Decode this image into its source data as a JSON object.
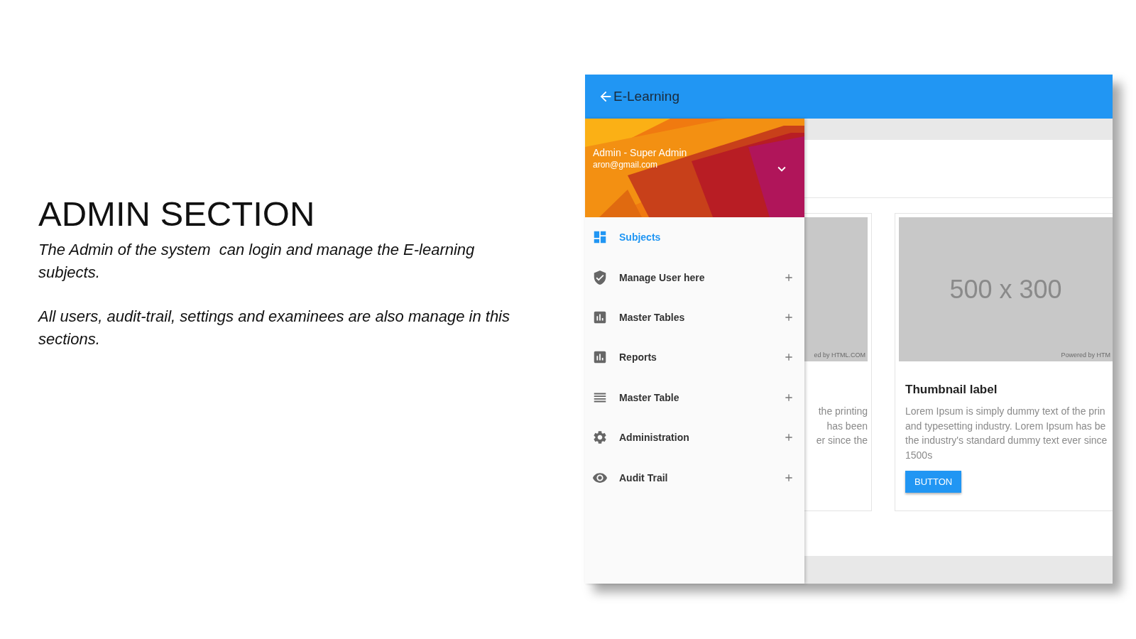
{
  "slide": {
    "title": "ADMIN SECTION",
    "paragraphs": [
      "The Admin of the system  can login and manage the E-learning subjects.",
      "All users, audit-trail, settings and examinees are also manage in this sections."
    ]
  },
  "app_bar": {
    "title": "E-Learning"
  },
  "profile": {
    "name": "Admin - Super Admin",
    "email": "aron@gmail.com"
  },
  "menu": [
    {
      "label": "Subjects",
      "kind": "dashboard",
      "selected": true,
      "expandable": false
    },
    {
      "label": "Manage User here",
      "kind": "shield",
      "selected": false,
      "expandable": true
    },
    {
      "label": "Master Tables",
      "kind": "chart",
      "selected": false,
      "expandable": true
    },
    {
      "label": "Reports",
      "kind": "chart",
      "selected": false,
      "expandable": true
    },
    {
      "label": "Master Table",
      "kind": "list",
      "selected": false,
      "expandable": true
    },
    {
      "label": "Administration",
      "kind": "gear",
      "selected": false,
      "expandable": true
    },
    {
      "label": "Audit Trail",
      "kind": "eye",
      "selected": false,
      "expandable": true
    }
  ],
  "cards": [
    {
      "image_credit": "ed by HTML.COM",
      "lines": [
        "the printing",
        "has been",
        "er since the"
      ]
    },
    {
      "image_text": "500 x 300",
      "image_credit": "Powered by HTM",
      "title": "Thumbnail label",
      "lines": [
        "Lorem Ipsum is simply dummy text of the prin",
        "and typesetting industry. Lorem Ipsum has be",
        "the industry's standard dummy text ever since",
        "1500s"
      ],
      "button": "BUTTON"
    }
  ]
}
